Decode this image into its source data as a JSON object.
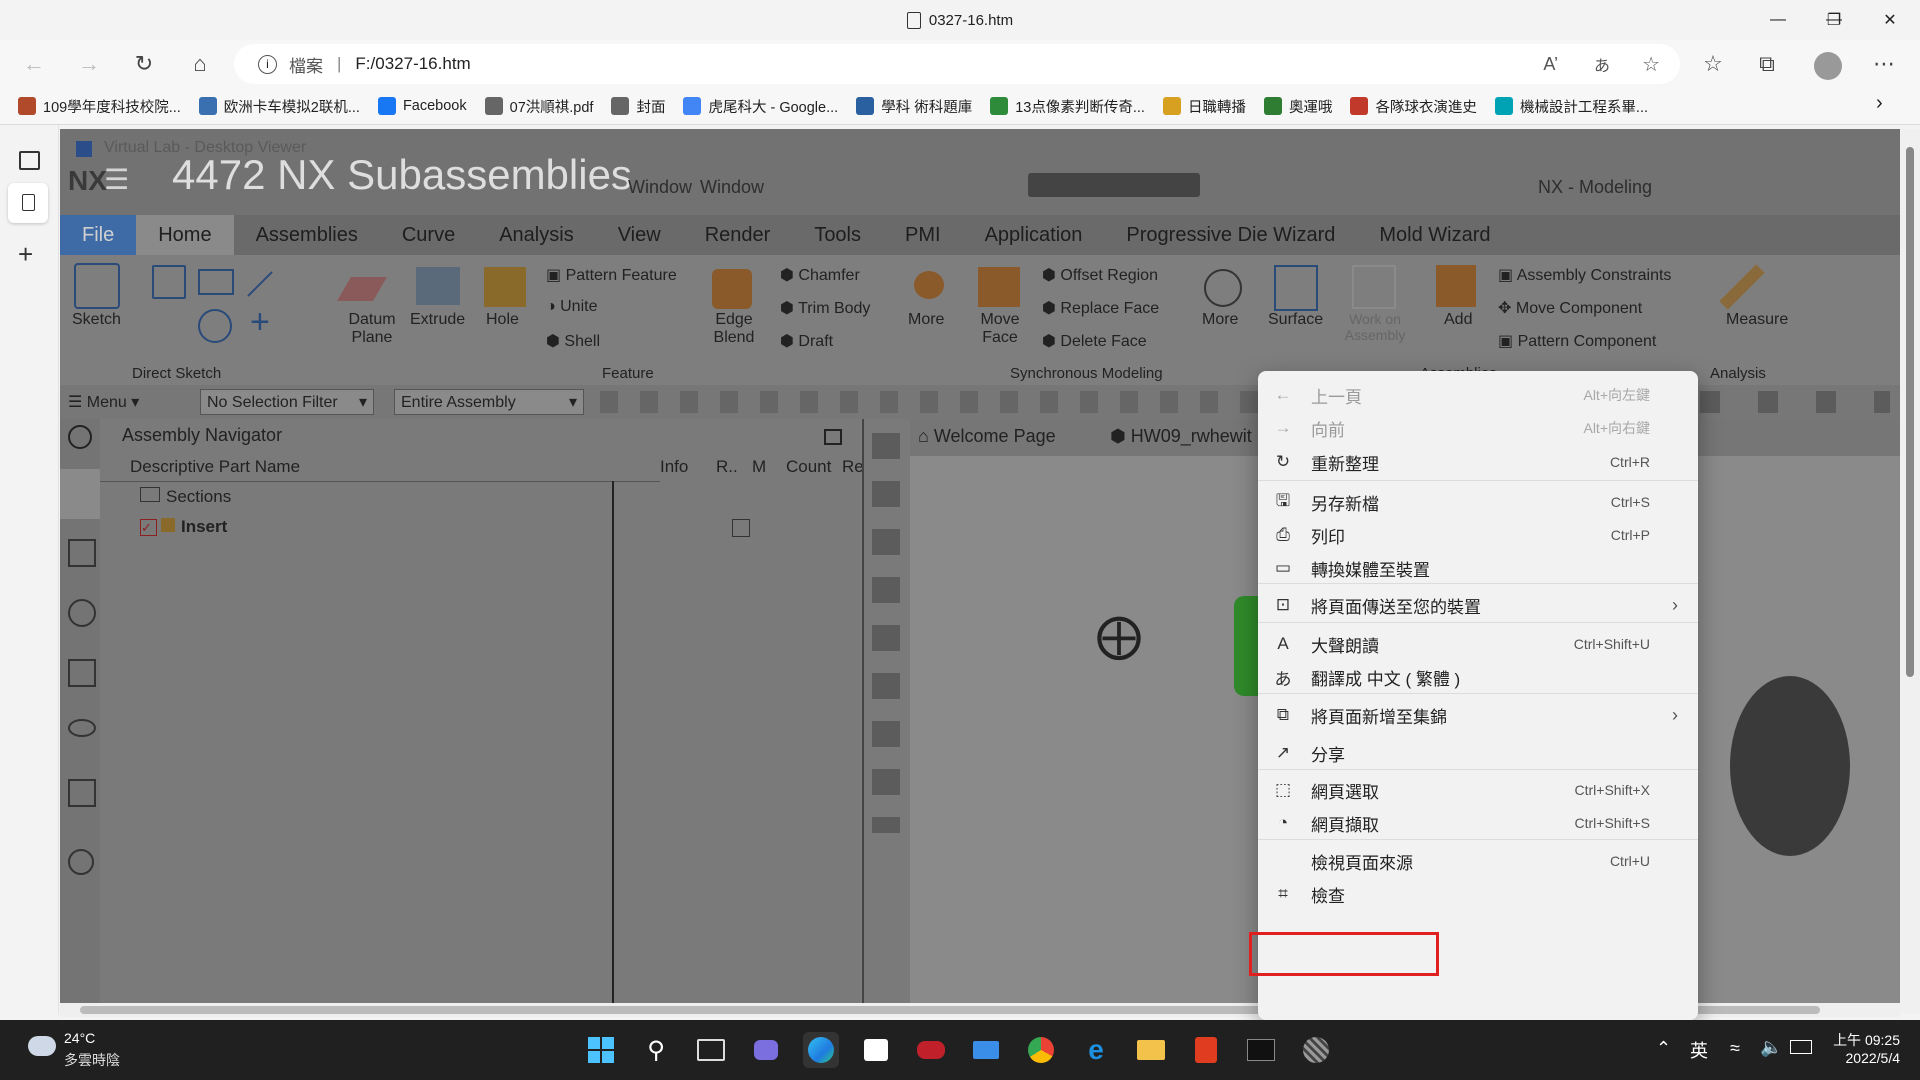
{
  "browser": {
    "tab_title": "0327-16.htm",
    "address_label": "檔案",
    "address_url": "F:/0327-16.htm",
    "favorites": [
      {
        "label": "109學年度科技校院...",
        "color": "#b04a2a"
      },
      {
        "label": "欧洲卡车模拟2联机...",
        "color": "#3a6fb0"
      },
      {
        "label": "Facebook",
        "color": "#1877f2"
      },
      {
        "label": "07洪順祺.pdf",
        "color": "#666666"
      },
      {
        "label": "封面",
        "color": "#666666"
      },
      {
        "label": "虎尾科大 - Google...",
        "color": "#4285f4"
      },
      {
        "label": "學科 術科題庫",
        "color": "#2a5fa0"
      },
      {
        "label": "13点像素判断传奇...",
        "color": "#2e8b3a"
      },
      {
        "label": "日職轉播",
        "color": "#d8a020"
      },
      {
        "label": "奧運哦",
        "color": "#2e7d32"
      },
      {
        "label": "各隊球衣演進史",
        "color": "#c0392b"
      },
      {
        "label": "機械設計工程系畢...",
        "color": "#00a3b4"
      }
    ]
  },
  "nx": {
    "window_caption": "Virtual Lab - Desktop Viewer",
    "overlay_title": "4472 NX Subassemblies",
    "logo": "NX",
    "window_menu_1": "Window",
    "window_menu_2": "Window",
    "app_mode": "NX - Modeling",
    "tabs": [
      "File",
      "Home",
      "Assemblies",
      "Curve",
      "Analysis",
      "View",
      "Render",
      "Tools",
      "PMI",
      "Application",
      "Progressive Die Wizard",
      "Mold Wizard"
    ],
    "ribbon": {
      "sketch": "Sketch",
      "direct_sketch": "Direct Sketch",
      "datum_plane": "Datum Plane",
      "extrude": "Extrude",
      "hole": "Hole",
      "pattern_feature": "Pattern Feature",
      "unite": "Unite",
      "shell": "Shell",
      "edge_blend": "Edge Blend",
      "chamfer": "Chamfer",
      "trim_body": "Trim Body",
      "draft": "Draft",
      "feature_group": "Feature",
      "more1": "More",
      "move_face": "Move Face",
      "offset_region": "Offset Region",
      "replace_face": "Replace Face",
      "delete_face": "Delete Face",
      "more2": "More",
      "sync_group": "Synchronous Modeling",
      "surface": "Surface",
      "work_on_assembly": "Work on Assembly",
      "add": "Add",
      "assembly_constraints": "Assembly Constraints",
      "move_component": "Move Component",
      "pattern_component": "Pattern Component",
      "assemblies_group": "Assemblies",
      "measure": "Measure",
      "analysis_group": "Analysis"
    },
    "toolbar": {
      "menu": "Menu",
      "filter": "No Selection Filter",
      "scope": "Entire Assembly"
    },
    "navigator": {
      "title": "Assembly Navigator",
      "columns": [
        "Descriptive Part Name",
        "Info",
        "R..",
        "M",
        "Count",
        "Re"
      ],
      "rows": [
        "Sections",
        "Insert"
      ]
    },
    "graphic_tabs": [
      "Welcome Page",
      "HW09_rwhewit"
    ]
  },
  "context_menu": {
    "items": [
      {
        "label": "上一頁",
        "shortcut": "Alt+向左鍵",
        "icon": "back-arrow-icon",
        "glyph": "←",
        "disabled": true
      },
      {
        "label": "向前",
        "shortcut": "Alt+向右鍵",
        "icon": "forward-arrow-icon",
        "glyph": "→",
        "disabled": true
      },
      {
        "label": "重新整理",
        "shortcut": "Ctrl+R",
        "icon": "refresh-icon",
        "glyph": "↻"
      },
      {
        "label": "另存新檔",
        "shortcut": "Ctrl+S",
        "icon": "save-as-icon",
        "glyph": "🖫"
      },
      {
        "label": "列印",
        "shortcut": "Ctrl+P",
        "icon": "print-icon",
        "glyph": "⎙"
      },
      {
        "label": "轉換媒體至裝置",
        "shortcut": "",
        "icon": "cast-icon",
        "glyph": "▭"
      },
      {
        "label": "將頁面傳送至您的裝置",
        "shortcut": "",
        "icon": "send-to-device-icon",
        "glyph": "⊡",
        "submenu": true
      },
      {
        "label": "大聲朗讀",
        "shortcut": "Ctrl+Shift+U",
        "icon": "read-aloud-icon",
        "glyph": "A"
      },
      {
        "label": "翻譯成 中文 ( 繁體 )",
        "shortcut": "",
        "icon": "translate-icon",
        "glyph": "あ"
      },
      {
        "label": "將頁面新增至集錦",
        "shortcut": "",
        "icon": "collections-icon",
        "glyph": "⧉",
        "submenu": true
      },
      {
        "label": "分享",
        "shortcut": "",
        "icon": "share-icon",
        "glyph": "↗"
      },
      {
        "label": "網頁選取",
        "shortcut": "Ctrl+Shift+X",
        "icon": "web-select-icon",
        "glyph": "⬚"
      },
      {
        "label": "網頁擷取",
        "shortcut": "Ctrl+Shift+S",
        "icon": "web-capture-icon",
        "glyph": "◔"
      },
      {
        "label": "檢視頁面來源",
        "shortcut": "Ctrl+U",
        "icon": "",
        "glyph": ""
      },
      {
        "label": "檢查",
        "shortcut": "",
        "icon": "inspect-icon",
        "glyph": "⌗"
      }
    ]
  },
  "taskbar": {
    "weather_temp": "24°C",
    "weather_desc": "多雲時陰",
    "ime": "英",
    "time": "上午 09:25",
    "date": "2022/5/4"
  }
}
